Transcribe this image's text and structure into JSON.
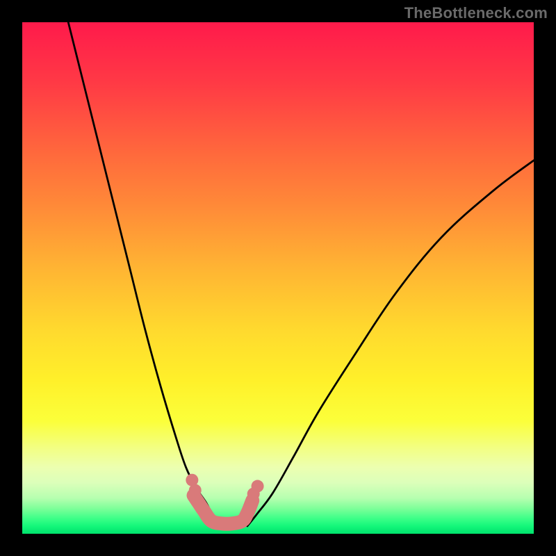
{
  "watermark": "TheBottleneck.com",
  "chart_data": {
    "type": "line",
    "title": "",
    "xlabel": "",
    "ylabel": "",
    "xlim": [
      0,
      100
    ],
    "ylim": [
      0,
      100
    ],
    "grid": false,
    "legend": false,
    "series": [
      {
        "name": "left-curve",
        "x": [
          9,
          12,
          15,
          18,
          21,
          24,
          27,
          30,
          32,
          34,
          36,
          37,
          38,
          39
        ],
        "y": [
          100,
          88,
          76,
          64,
          52,
          40,
          29,
          19,
          13,
          9,
          6,
          4,
          2.5,
          1.5
        ]
      },
      {
        "name": "right-curve",
        "x": [
          44,
          46,
          49,
          53,
          58,
          65,
          73,
          82,
          92,
          100
        ],
        "y": [
          1.5,
          4,
          8,
          15,
          24,
          35,
          47,
          58,
          67,
          73
        ]
      },
      {
        "name": "bottom-blob",
        "x": [
          33.5,
          34.5,
          35.5,
          37,
          39,
          41,
          43,
          44,
          45
        ],
        "y": [
          7.5,
          6,
          4.5,
          2.5,
          2,
          2,
          2.5,
          4,
          6.5
        ]
      },
      {
        "name": "blob-dot-left-1",
        "x": [
          33.2
        ],
        "y": [
          10.5
        ]
      },
      {
        "name": "blob-dot-left-2",
        "x": [
          33.8
        ],
        "y": [
          8.5
        ]
      },
      {
        "name": "blob-dot-right-1",
        "x": [
          45.2
        ],
        "y": [
          7.8
        ]
      },
      {
        "name": "blob-dot-right-2",
        "x": [
          46.0
        ],
        "y": [
          9.3
        ]
      }
    ],
    "colors": {
      "curve": "#000000",
      "blob": "#d97a7a"
    }
  }
}
